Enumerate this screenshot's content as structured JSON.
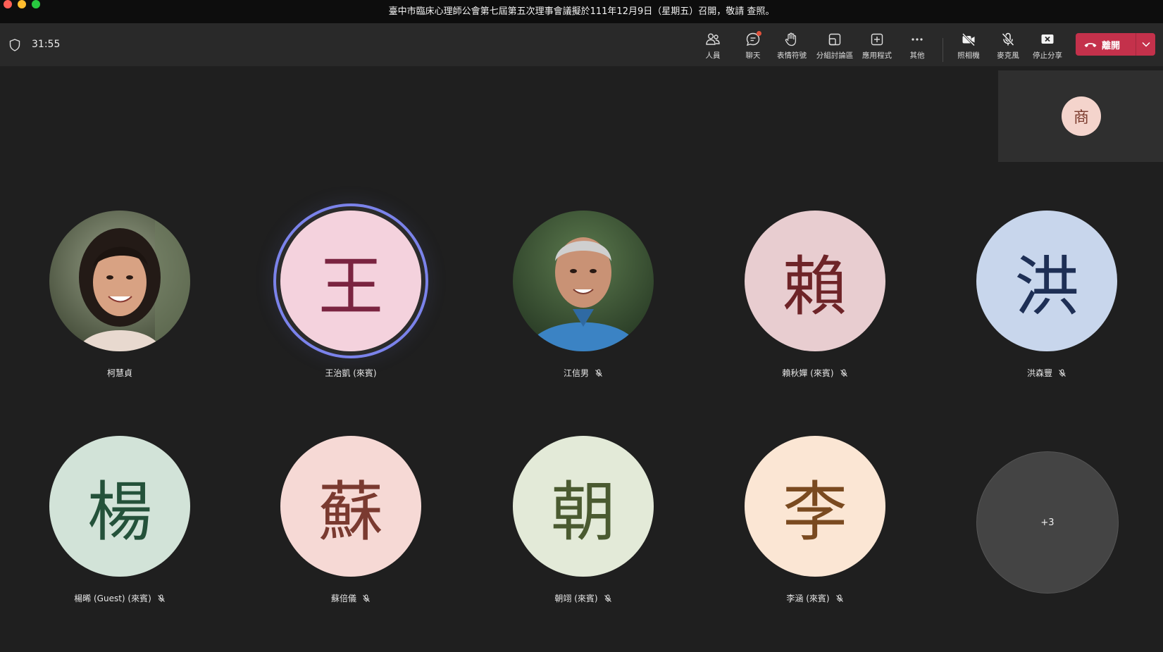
{
  "window": {
    "title": "臺中市臨床心理師公會第七屆第五次理事會議擬於111年12月9日（星期五）召開，敬請 查照。"
  },
  "meeting": {
    "duration": "31:55"
  },
  "toolbar": {
    "people": "人員",
    "chat": "聊天",
    "reactions": "表情符號",
    "rooms": "分組討論區",
    "apps": "應用程式",
    "more": "其他",
    "camera": "照相機",
    "mic": "麥克風",
    "share": "停止分享",
    "leave": "離開"
  },
  "self_view": {
    "initial": "商"
  },
  "participants": [
    {
      "name": "柯慧貞",
      "muted": false,
      "photo": true
    },
    {
      "name": "王治凱 (來賓)",
      "initial": "王",
      "muted": false,
      "speaking": true,
      "bg": "#f4d2dd",
      "fg": "#7a2440"
    },
    {
      "name": "江信男",
      "muted": true,
      "photo": true
    },
    {
      "name": "賴秋嬋 (來賓)",
      "initial": "賴",
      "muted": true,
      "bg": "#e8cdd0",
      "fg": "#6e2428"
    },
    {
      "name": "洪森豐",
      "initial": "洪",
      "muted": true,
      "bg": "#c8d6ec",
      "fg": "#1e2f55"
    },
    {
      "name": "楊晞 (Guest) (來賓)",
      "initial": "楊",
      "muted": true,
      "bg": "#d2e3d8",
      "fg": "#24523a"
    },
    {
      "name": "蘇倍儀",
      "initial": "蘇",
      "muted": true,
      "bg": "#f6d9d5",
      "fg": "#7a3a30"
    },
    {
      "name": "朝翊 (來賓)",
      "initial": "朝",
      "muted": true,
      "bg": "#e3ead8",
      "fg": "#4a5a30"
    },
    {
      "name": "李涵 (來賓)",
      "initial": "李",
      "muted": true,
      "bg": "#fbe6d4",
      "fg": "#7a4a20"
    }
  ],
  "overflow": {
    "label": "+3"
  }
}
